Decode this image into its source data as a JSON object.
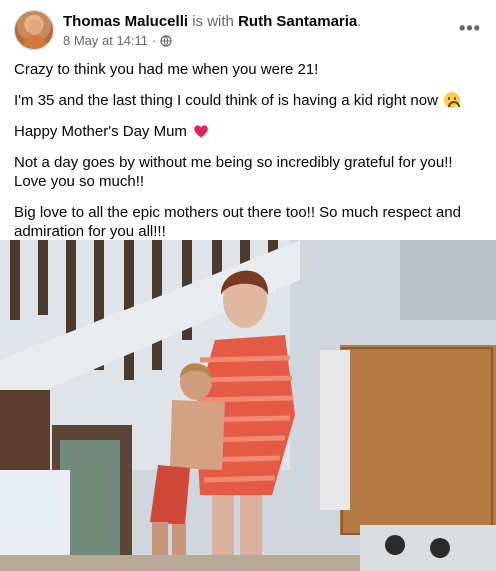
{
  "post": {
    "author": "Thomas Malucelli",
    "with_text": "is with",
    "tagged": "Ruth Santamaria",
    "tagged_suffix": ".",
    "timestamp": "8 May at 14:11",
    "separator": "·",
    "audience_icon": "globe-icon",
    "more_icon": "more-options-icon",
    "more_glyph": "•••",
    "lines": [
      "Crazy to think you had me when you were 21!",
      "I'm 35 and the last thing I could think of is having a kid right now",
      "Happy Mother's Day Mum",
      "Not a day goes by without me being so incredibly grateful for you!! Love you so much!!",
      "Big love to all the epic mothers out there too!! So much respect and admiration for you all!!!"
    ],
    "emoji_1": "upside-down-face-emoji",
    "emoji_2": "red-heart-emoji"
  },
  "colors": {
    "text": "#050505",
    "muted": "#65676b",
    "heart": "#e0245e"
  }
}
